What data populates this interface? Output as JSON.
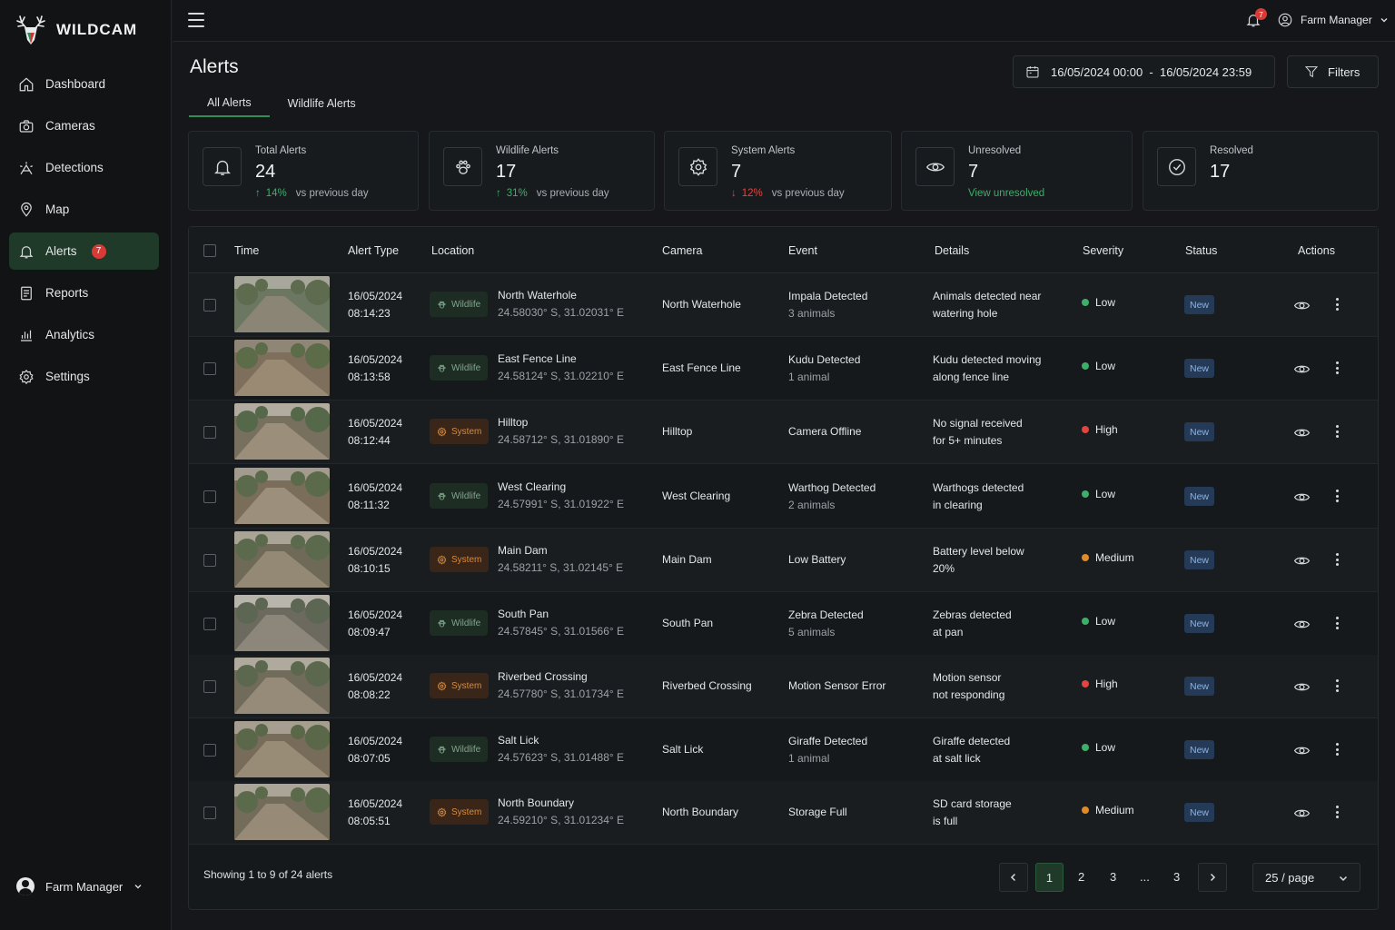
{
  "brand": {
    "name": "WILDCAM"
  },
  "sidebar": {
    "items": [
      {
        "label": "Dashboard",
        "icon": "home-icon"
      },
      {
        "label": "Cameras",
        "icon": "camera-icon"
      },
      {
        "label": "Detections",
        "icon": "detection-icon"
      },
      {
        "label": "Map",
        "icon": "map-pin-icon"
      },
      {
        "label": "Alerts",
        "icon": "bell-icon",
        "badge": "7",
        "active": true
      },
      {
        "label": "Reports",
        "icon": "report-icon"
      },
      {
        "label": "Analytics",
        "icon": "analytics-icon"
      },
      {
        "label": "Settings",
        "icon": "gear-icon"
      }
    ],
    "user": "Farm Manager"
  },
  "topbar": {
    "notifications": "7",
    "user": "Farm Manager"
  },
  "page": {
    "title": "Alerts",
    "tabs": [
      "All Alerts",
      "Wildlife Alerts"
    ],
    "date_range": "16/05/2024 00:00  -  16/05/2024 23:59",
    "filters_label": "Filters"
  },
  "stats": [
    {
      "label": "Total Alerts",
      "value": "24",
      "trend": "14%",
      "trend_dir": "up",
      "note": "vs previous day"
    },
    {
      "label": "Wildlife Alerts",
      "value": "17",
      "trend": "31%",
      "trend_dir": "up",
      "note": "vs previous day"
    },
    {
      "label": "System Alerts",
      "value": "7",
      "trend": "12%",
      "trend_dir": "down",
      "note": "vs previous day"
    },
    {
      "label": "Unresolved",
      "value": "7",
      "link": "View unresolved"
    },
    {
      "label": "Resolved",
      "value": "17"
    }
  ],
  "table": {
    "headers": [
      "Time",
      "Alert Type",
      "Location",
      "Camera",
      "Event",
      "Details",
      "Severity",
      "Status",
      "Actions"
    ],
    "rows": [
      {
        "date": "16/05/2024",
        "time": "08:14:23",
        "type": "Wildlife",
        "loc": "North Waterhole",
        "coords": "24.58030° S, 31.02031° E",
        "camera": "North Waterhole",
        "event": "Impala Detected",
        "event_sub": "3 animals",
        "d1": "Animals detected near",
        "d2": "watering hole",
        "severity": "Low",
        "status": "New"
      },
      {
        "date": "16/05/2024",
        "time": "08:13:58",
        "type": "Wildlife",
        "loc": "East Fence Line",
        "coords": "24.58124° S, 31.02210° E",
        "camera": "East Fence Line",
        "event": "Kudu Detected",
        "event_sub": "1 animal",
        "d1": "Kudu detected moving",
        "d2": "along fence line",
        "severity": "Low",
        "status": "New"
      },
      {
        "date": "16/05/2024",
        "time": "08:12:44",
        "type": "System",
        "loc": "Hilltop",
        "coords": "24.58712° S, 31.01890° E",
        "camera": "Hilltop",
        "event": "Camera Offline",
        "event_sub": "",
        "d1": "No signal received",
        "d2": "for 5+ minutes",
        "severity": "High",
        "status": "New"
      },
      {
        "date": "16/05/2024",
        "time": "08:11:32",
        "type": "Wildlife",
        "loc": "West Clearing",
        "coords": "24.57991° S, 31.01922° E",
        "camera": "West Clearing",
        "event": "Warthog Detected",
        "event_sub": "2 animals",
        "d1": "Warthogs detected",
        "d2": "in clearing",
        "severity": "Low",
        "status": "New"
      },
      {
        "date": "16/05/2024",
        "time": "08:10:15",
        "type": "System",
        "loc": "Main Dam",
        "coords": "24.58211° S, 31.02145° E",
        "camera": "Main Dam",
        "event": "Low Battery",
        "event_sub": "",
        "d1": "Battery level below",
        "d2": "20%",
        "severity": "Medium",
        "status": "New"
      },
      {
        "date": "16/05/2024",
        "time": "08:09:47",
        "type": "Wildlife",
        "loc": "South Pan",
        "coords": "24.57845° S, 31.01566° E",
        "camera": "South Pan",
        "event": "Zebra Detected",
        "event_sub": "5 animals",
        "d1": "Zebras detected",
        "d2": "at pan",
        "severity": "Low",
        "status": "New"
      },
      {
        "date": "16/05/2024",
        "time": "08:08:22",
        "type": "System",
        "loc": "Riverbed Crossing",
        "coords": "24.57780° S, 31.01734° E",
        "camera": "Riverbed Crossing",
        "event": "Motion Sensor Error",
        "event_sub": "",
        "d1": "Motion sensor",
        "d2": "not responding",
        "severity": "High",
        "status": "New"
      },
      {
        "date": "16/05/2024",
        "time": "08:07:05",
        "type": "Wildlife",
        "loc": "Salt Lick",
        "coords": "24.57623° S, 31.01488° E",
        "camera": "Salt Lick",
        "event": "Giraffe Detected",
        "event_sub": "1 animal",
        "d1": "Giraffe detected",
        "d2": "at salt lick",
        "severity": "Low",
        "status": "New"
      },
      {
        "date": "16/05/2024",
        "time": "08:05:51",
        "type": "System",
        "loc": "North Boundary",
        "coords": "24.59210° S, 31.01234° E",
        "camera": "North Boundary",
        "event": "Storage Full",
        "event_sub": "",
        "d1": "SD card storage",
        "d2": "is full",
        "severity": "Medium",
        "status": "New"
      }
    ]
  },
  "pagination": {
    "showing": "Showing 1 to 9 of 24 alerts",
    "pages": [
      "1",
      "2",
      "3",
      "...",
      "3"
    ],
    "current": "1",
    "per_page": "25 / page"
  },
  "colors": {
    "accent": "#2f8f56",
    "severity_low": "#3fae6b",
    "severity_medium": "#e08a2c",
    "severity_high": "#e0463f"
  }
}
